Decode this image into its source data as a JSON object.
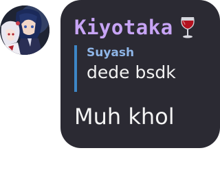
{
  "message": {
    "author": "Kiyotaka",
    "author_emoji_icon": "wine-glass-icon",
    "author_color": "#c7a4f5",
    "reply": {
      "author": "Suyash",
      "text": "dede bsdk",
      "bar_color": "#3d86c6"
    },
    "text": "Muh khol"
  }
}
